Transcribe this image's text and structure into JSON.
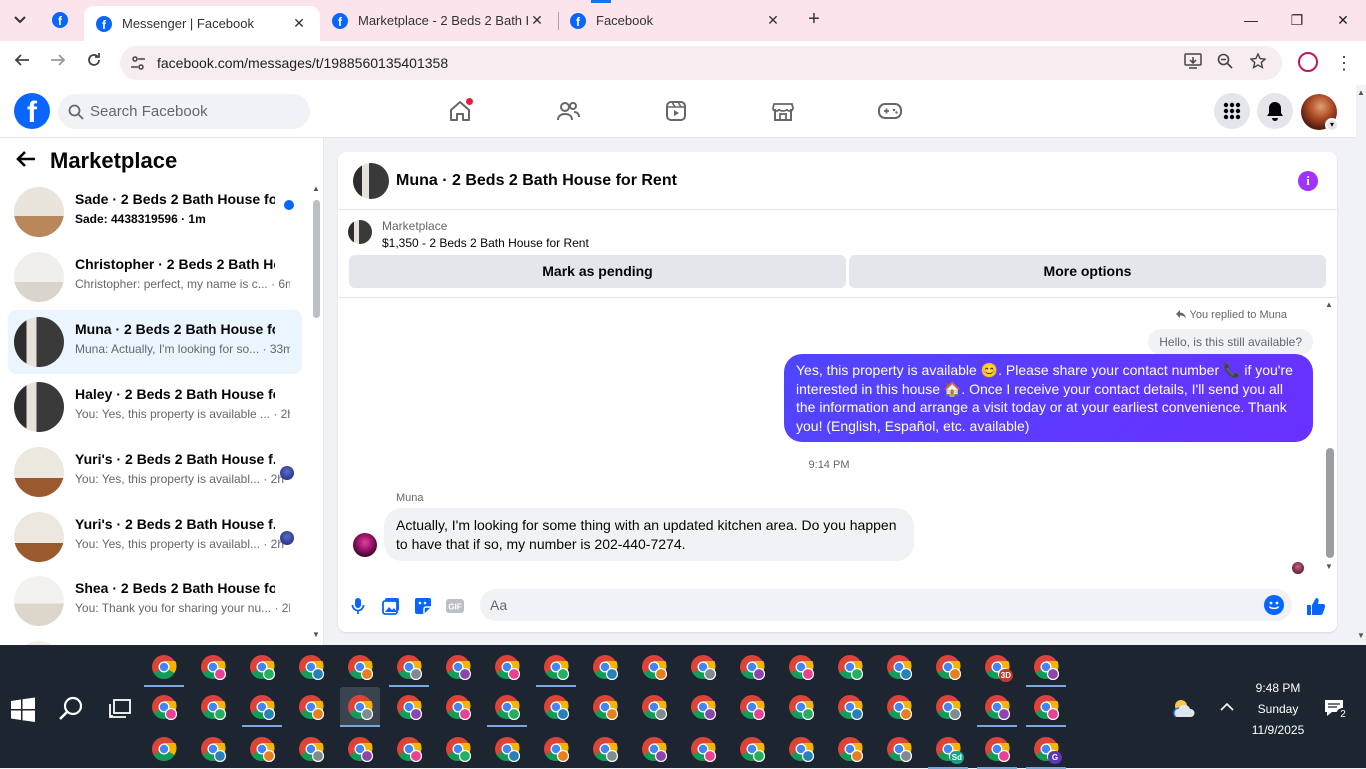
{
  "browser": {
    "tabs": [
      {
        "title": "Messenger | Facebook",
        "active": true
      },
      {
        "title": "Marketplace - 2 Beds 2 Bath Ho",
        "active": false
      },
      {
        "title": "Facebook",
        "active": false
      }
    ],
    "url": "facebook.com/messages/t/1988560135401358"
  },
  "facebook": {
    "search_placeholder": "Search Facebook",
    "logo_letter": "f"
  },
  "sidebar": {
    "title": "Marketplace",
    "conversations": [
      {
        "name": "Sade · 2 Beds 2 Bath House fo...",
        "preview": "Sade: 4438319596 · 1m",
        "unread": true,
        "selected": false
      },
      {
        "name": "Christopher · 2 Beds 2 Bath Hou...",
        "preview": "Christopher: perfect, my name is c... · 6m",
        "unread": false,
        "selected": false
      },
      {
        "name": "Muna · 2 Beds 2 Bath House for ...",
        "preview": "Muna: Actually, I'm looking for so... · 33m",
        "unread": false,
        "selected": true
      },
      {
        "name": "Haley · 2 Beds 2 Bath House for ...",
        "preview": "You: Yes, this property is available ... · 2h",
        "unread": false,
        "selected": false
      },
      {
        "name": "Yuri's · 2 Beds 2 Bath House f...",
        "preview": "You: Yes, this property is availabl... · 2h",
        "unread": false,
        "selected": false
      },
      {
        "name": "Yuri's · 2 Beds 2 Bath House f...",
        "preview": "You: Yes, this property is availabl... · 2h",
        "unread": false,
        "selected": false
      },
      {
        "name": "Shea · 2 Beds 2 Bath House for ...",
        "preview": "You: Thank you for sharing your nu... · 2h",
        "unread": false,
        "selected": false
      }
    ]
  },
  "chat": {
    "title": "Muna · 2 Beds 2 Bath House for Rent",
    "listing_type": "Marketplace",
    "listing_title": "$1,350 - 2 Beds 2 Bath House for Rent",
    "mark_pending_label": "Mark as pending",
    "more_options_label": "More options",
    "replied_label": "You replied to Muna",
    "quoted_message": "Hello, is this still available?",
    "outgoing_message": "Yes, this property is available 😊. Please share your contact number 📞 if you're interested in this house 🏠. Once I receive your contact details, I'll send you all the information and arrange a visit today or at your earliest convenience. Thank you! (English, Español, etc. available)",
    "timestamp": "9:14 PM",
    "sender_name": "Muna",
    "incoming_message": "Actually, I'm looking for some thing with an updated kitchen area. Do you happen to have that if so, my number is 202-440-7274.",
    "composer_placeholder": "Aa"
  },
  "taskbar": {
    "time": "9:48 PM",
    "day": "Sunday",
    "date": "11/9/2025",
    "notification_count": "2",
    "badge_labels": [
      "3D",
      "Sd",
      "G"
    ]
  },
  "colors": {
    "facebook_blue": "#0866ff",
    "outgoing_bubble": "#5b3cff",
    "selected_row": "#ebf5ff",
    "tabstrip": "#fce4ec",
    "taskbar": "#1c2530"
  }
}
